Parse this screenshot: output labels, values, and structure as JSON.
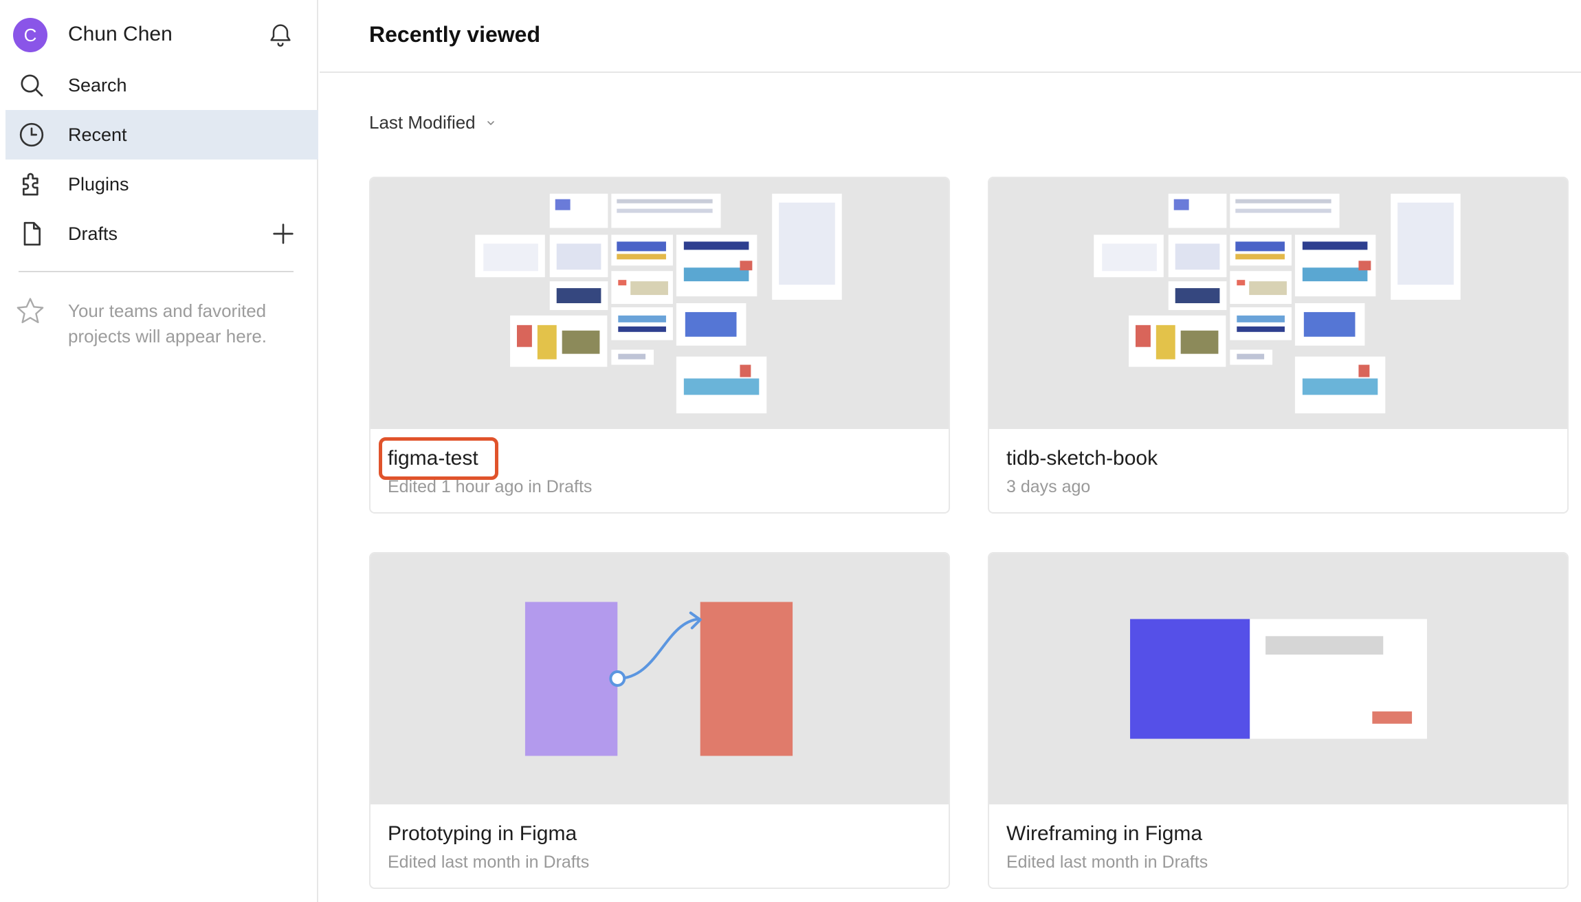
{
  "user": {
    "avatar_letter": "C",
    "name": "Chun Chen"
  },
  "sidebar": {
    "items": [
      {
        "label": "Search",
        "icon": "search-icon"
      },
      {
        "label": "Recent",
        "icon": "clock-icon",
        "active": true
      },
      {
        "label": "Plugins",
        "icon": "plugin-icon"
      },
      {
        "label": "Drafts",
        "icon": "file-icon"
      }
    ],
    "teams_message": "Your teams and favorited projects will appear here."
  },
  "main": {
    "title": "Recently viewed",
    "sort_label": "Last Modified",
    "files": [
      {
        "title": "figma-test",
        "subtitle": "Edited 1 hour ago in Drafts",
        "highlighted": true
      },
      {
        "title": "tidb-sketch-book",
        "subtitle": "3 days ago"
      },
      {
        "title": "Prototyping in Figma",
        "subtitle": "Edited last month in Drafts"
      },
      {
        "title": "Wireframing in Figma",
        "subtitle": "Edited last month in Drafts"
      }
    ]
  },
  "colors": {
    "avatar": "#8a55e8",
    "active_nav": "#e2e9f2",
    "highlight": "#e0532b",
    "proto_left": "#b39aed",
    "proto_right": "#e07b6b",
    "wire_blue": "#5550e8"
  }
}
